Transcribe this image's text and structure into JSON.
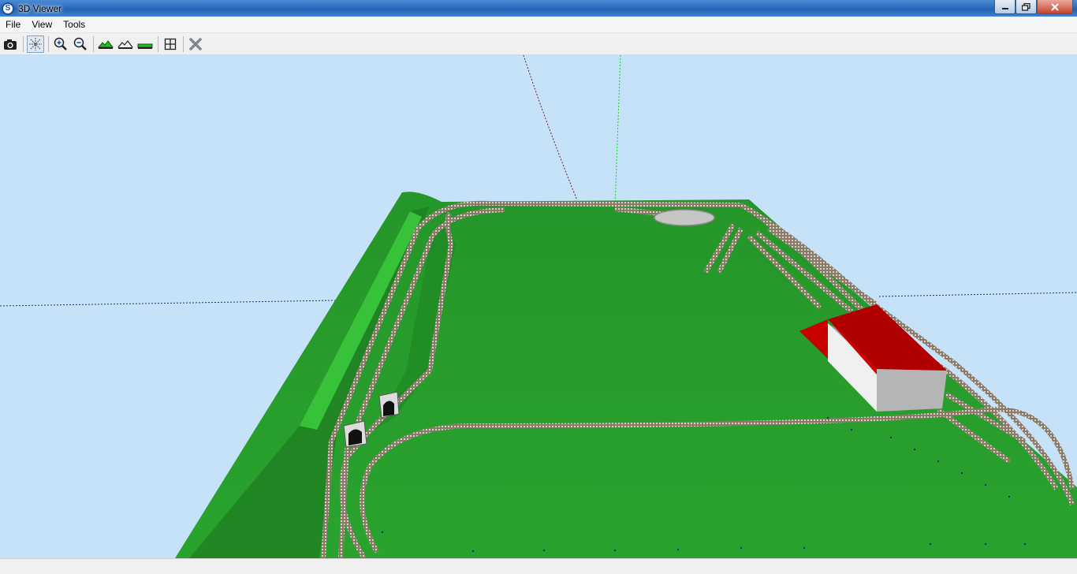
{
  "window": {
    "title": "3D Viewer",
    "app_icon": "S"
  },
  "window_buttons": {
    "minimize": "minimize-icon",
    "restore": "restore-icon",
    "close": "close-icon"
  },
  "menu": [
    {
      "label": "File"
    },
    {
      "label": "View"
    },
    {
      "label": "Tools"
    }
  ],
  "toolbar": {
    "buttons": [
      {
        "icon": "camera-icon"
      },
      {
        "icon": "axes-icon",
        "active": true
      },
      {
        "icon": "zoom-in-icon"
      },
      {
        "icon": "zoom-out-icon"
      },
      {
        "icon": "terrain-raise-icon"
      },
      {
        "icon": "terrain-outline-icon"
      },
      {
        "icon": "terrain-flat-icon"
      },
      {
        "icon": "fit-view-icon"
      },
      {
        "icon": "close-view-icon"
      }
    ]
  },
  "scene": {
    "sky_color": "#c6e2f8",
    "ground_color": "#2ea12e",
    "building_roof_color": "#b00000",
    "building_wall_color": "#e8e8e8"
  }
}
